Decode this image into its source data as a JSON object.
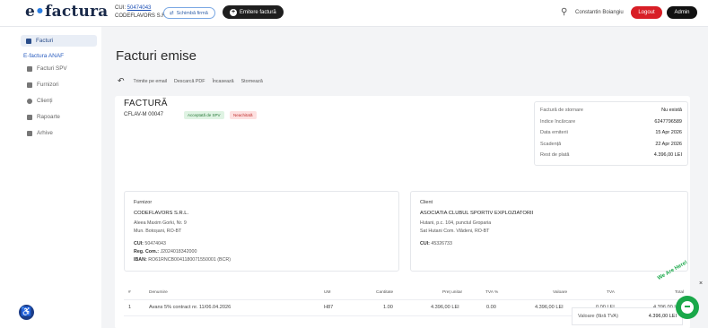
{
  "header": {
    "logo_e": "e",
    "logo_dot": "•",
    "logo_rest": "factura",
    "cui_label": "CUI: ",
    "cui_value": "50474043",
    "company": "CODEFLAVORS S.R.L.",
    "change_company": "Schimbă firmă",
    "emit_button": "Emitere factură",
    "user_name": "Constantin Boiangiu",
    "logout": "Logout",
    "admin": "Admin"
  },
  "sidebar": {
    "items": [
      {
        "label": "Facturi",
        "icon": "invoice-icon"
      },
      {
        "label": "Facturi SPV",
        "icon": "spv-icon"
      },
      {
        "label": "Furnizori",
        "icon": "suppliers-icon"
      },
      {
        "label": "Clienți",
        "icon": "clients-icon"
      },
      {
        "label": "Rapoarte",
        "icon": "reports-icon"
      },
      {
        "label": "Arhive",
        "icon": "archive-icon"
      }
    ],
    "section": "E-factura ANAF"
  },
  "page": {
    "title": "Facturi emise",
    "actions": [
      "Trimite pe email",
      "Descarcă PDF",
      "Încasează",
      "Stornează"
    ]
  },
  "invoice": {
    "title": "FACTURĂ",
    "number": "CFLAV-M 00047",
    "badge_spv": "Acceptată de SPV",
    "badge_status": "Neachitată",
    "summary": [
      {
        "label": "Factură de stornare",
        "value": "Nu există"
      },
      {
        "label": "Indice încărcare",
        "value": "6247796589"
      },
      {
        "label": "Data emiterii",
        "value": "15 Apr 2026"
      },
      {
        "label": "Scadență",
        "value": "22 Apr 2026"
      },
      {
        "label": "Rest de plată",
        "value": "4.396,00 LEI"
      }
    ],
    "supplier": {
      "heading": "Furnizor",
      "name": "CODEFLAVORS S.R.L.",
      "address1": "Aleea Maxim Gorki, Nr. 9",
      "address2": "Mun. Botoșani, RO-BT",
      "cui_label": "CUI:",
      "cui": "50474043",
      "reg_label": "Reg. Com.:",
      "reg": "J2024018342000",
      "iban_label": "IBAN:",
      "iban": "RO61RNCB0041180071550001 (BCR)"
    },
    "client": {
      "heading": "Client",
      "name": "ASOCIATIA CLUBUL SPORTIV EXPLOZIATORII",
      "address1": "Hutani, p.c. 104, punctul Groparia",
      "address2": "Sat Hutani Com. Vlădeni, RO-BT",
      "cui_label": "CUI:",
      "cui": "45326733"
    },
    "table": {
      "headers": [
        "#",
        "Denumire",
        "UM",
        "Cantitate",
        "Preț unitar",
        "TVA %",
        "Valoare",
        "TVA",
        "Total"
      ],
      "rows": [
        [
          "1",
          "Avans 5% contract nr. 11/06.04.2026",
          "H87",
          "1.00",
          "4.396,00 LEI",
          "0.00",
          "4.396,00 LEI",
          "0,00 LEI",
          "4.396,00 LEI"
        ]
      ]
    },
    "total_label": "Valoare (fără TVA)",
    "total_value": "4.396,00 LEI"
  },
  "chat": {
    "label": "We Are Here!",
    "close": "×"
  }
}
